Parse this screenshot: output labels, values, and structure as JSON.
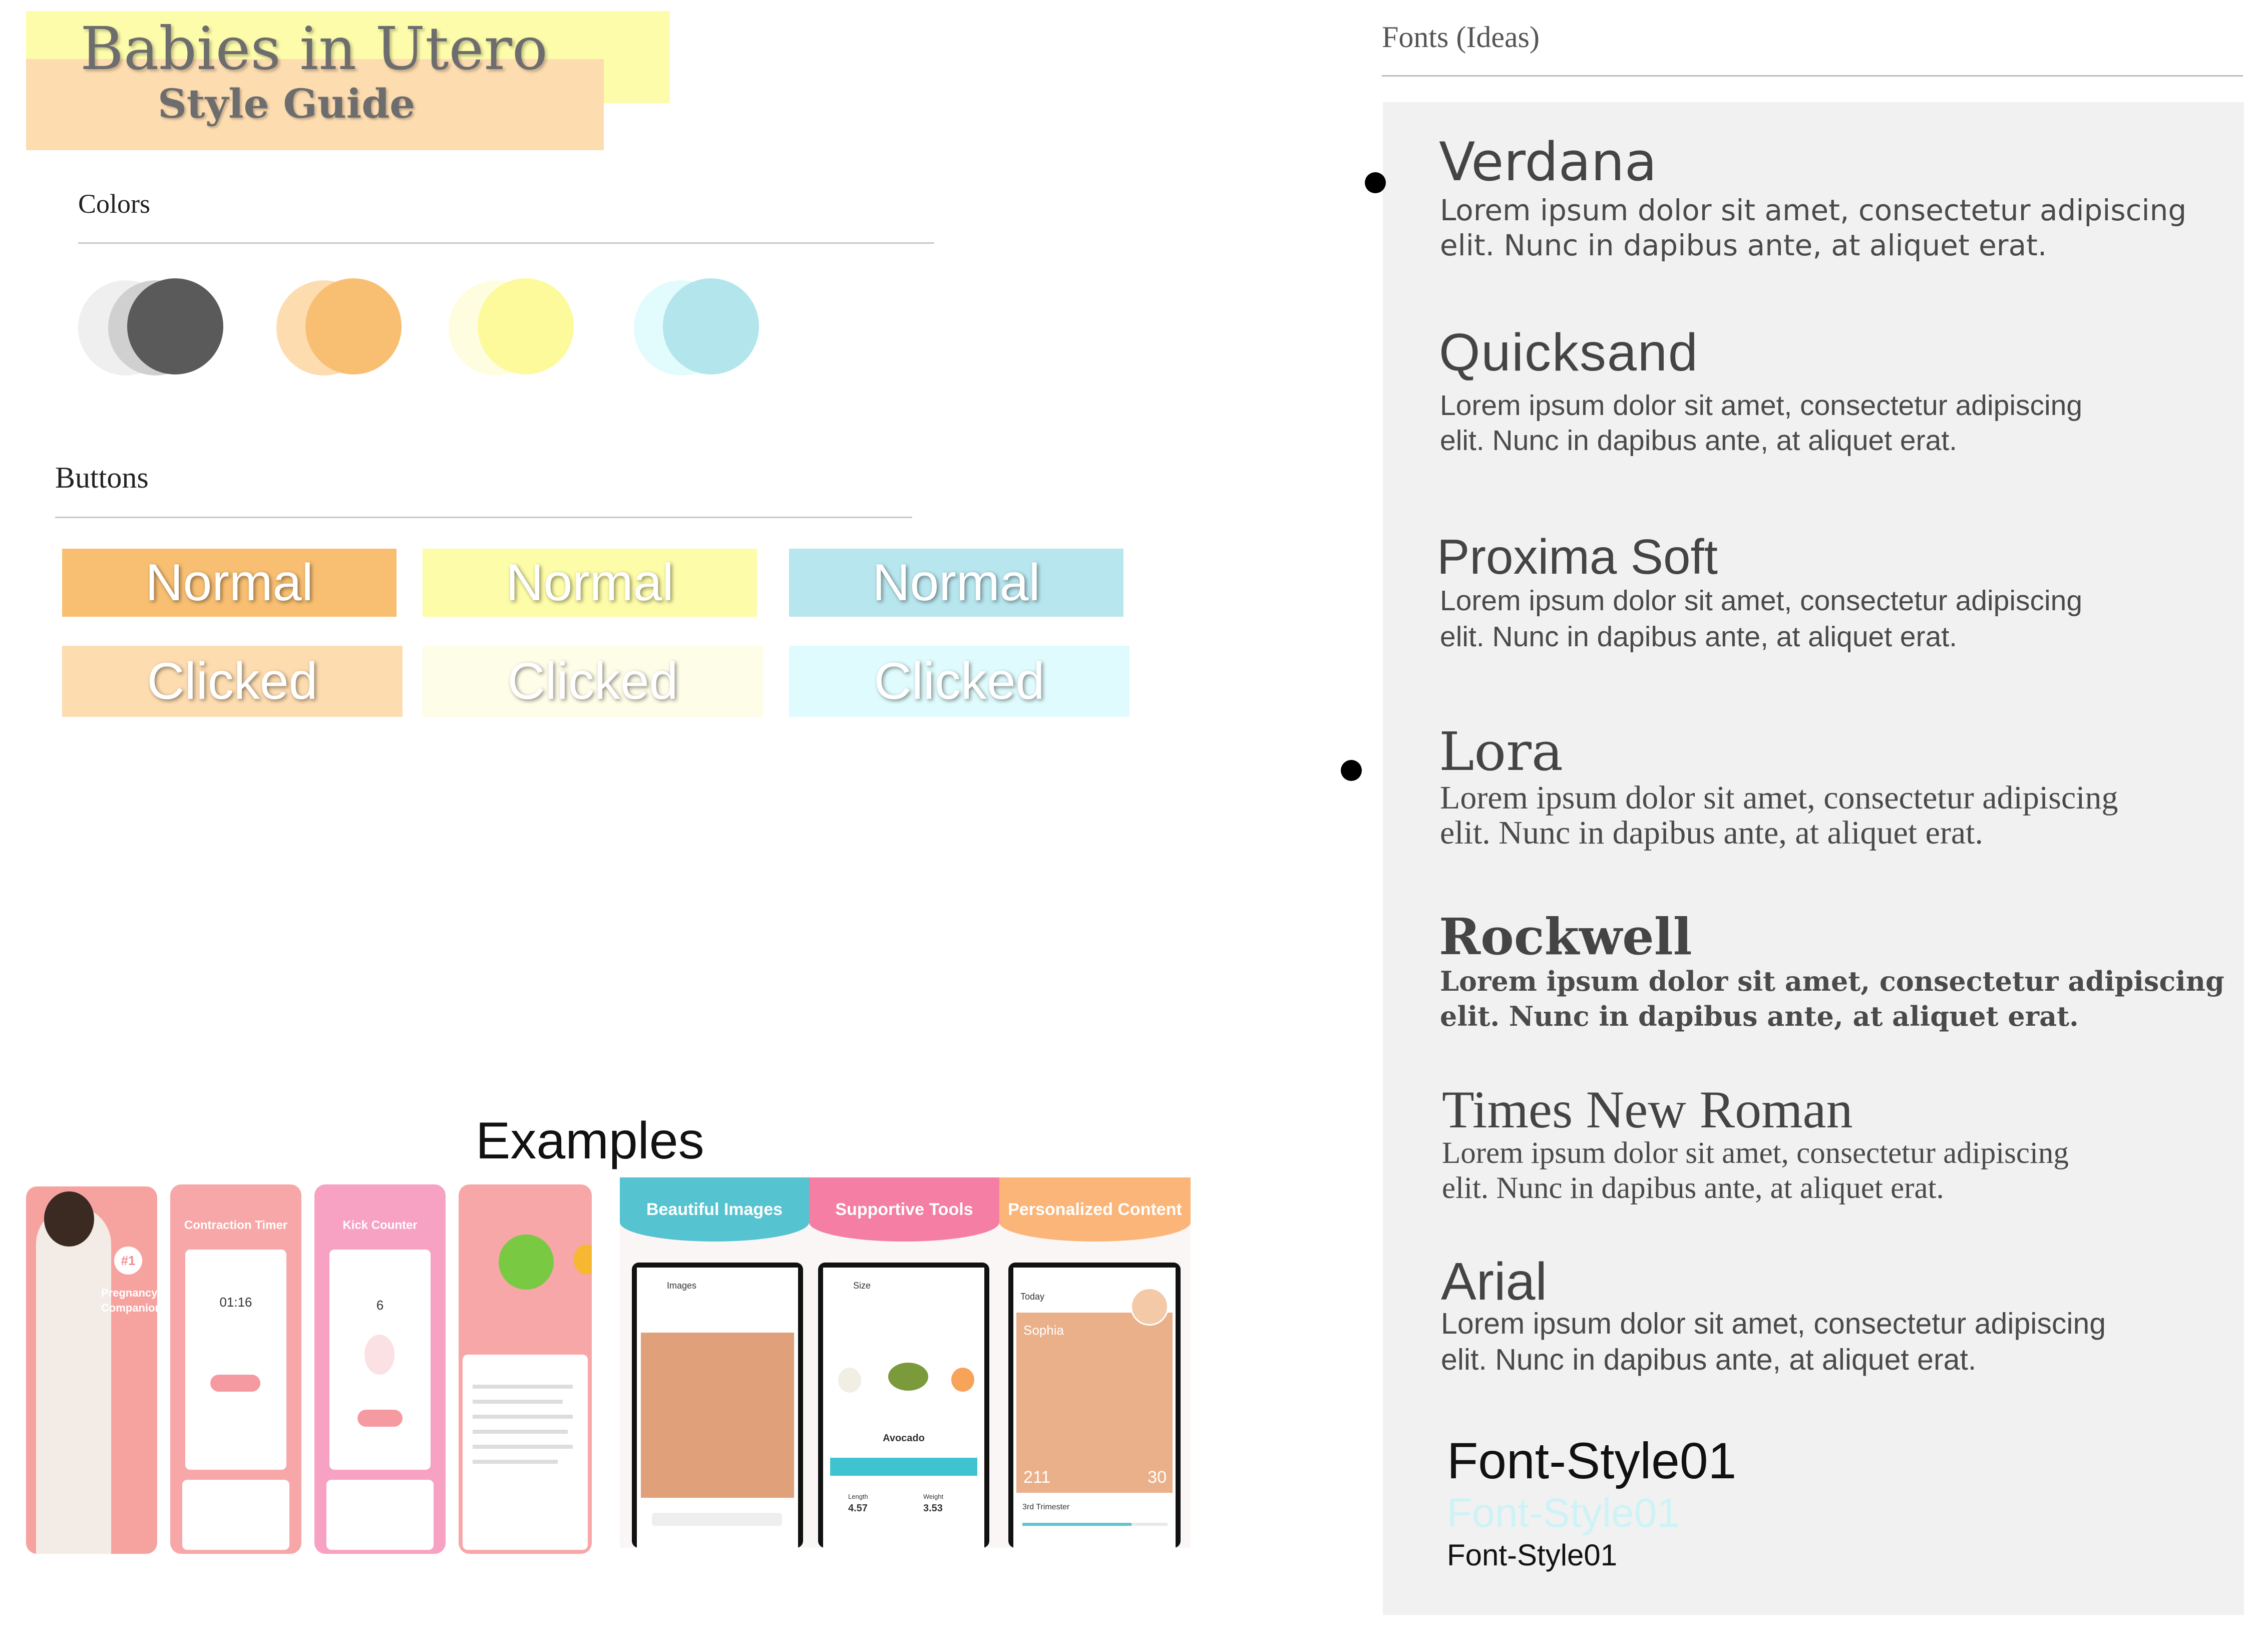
{
  "header": {
    "title": "Babies in Utero",
    "subtitle": "Style Guide"
  },
  "colors": {
    "heading": "Colors",
    "swatches": [
      {
        "name": "dark-gray",
        "main": "#5a5a5a",
        "light": "#efefef",
        "mid": "#d0d0d0"
      },
      {
        "name": "orange",
        "main": "#f8bf72",
        "light": "#fddcb0"
      },
      {
        "name": "yellow",
        "main": "#fdfa9c",
        "light": "#fefde0"
      },
      {
        "name": "aqua",
        "main": "#b3e5ec",
        "light": "#e2fbfd"
      }
    ]
  },
  "buttons": {
    "heading": "Buttons",
    "normal_label": "Normal",
    "clicked_label": "Clicked",
    "normal_colors": [
      "#f8bf72",
      "#fdfca8",
      "#b8e6ee"
    ],
    "clicked_colors": [
      "#fddcb0",
      "#fefde8",
      "#e0fbfd"
    ]
  },
  "examples": {
    "heading": "Examples",
    "left_app": {
      "hero_badge": "#1",
      "hero_text": [
        "Pregnancy",
        "Companion"
      ],
      "screens": [
        "Contraction Timer",
        "Kick Counter"
      ],
      "timer_value": "01:16",
      "kick_value": "6"
    },
    "right_app": {
      "panels": [
        "Beautiful Images",
        "Supportive Tools",
        "Personalized Content"
      ],
      "panel_colors": [
        "#56c3d1",
        "#f47ea4",
        "#fbb578"
      ],
      "images_title": "Images",
      "size_title": "Size",
      "fruit": "Avocado",
      "length_label": "Length",
      "length_value": "4.57",
      "weight_label": "Weight",
      "weight_value": "3.53",
      "today_label": "Today",
      "baby_name": "Sophia",
      "days_value": "211",
      "weeks_value": "30",
      "trimester": "3rd Trimester"
    }
  },
  "fonts": {
    "heading": "Fonts (Ideas)",
    "sample_line1": "Lorem ipsum dolor sit amet, consectetur adipiscing",
    "sample_line2": "elit. Nunc in dapibus ante, at aliquet erat.",
    "items": [
      {
        "name": "Verdana",
        "bullet": true
      },
      {
        "name": "Quicksand",
        "bullet": false
      },
      {
        "name": "Proxima Soft",
        "bullet": false
      },
      {
        "name": "Lora",
        "bullet": true
      },
      {
        "name": "Rockwell",
        "bullet": false
      },
      {
        "name": "Times New Roman",
        "bullet": false
      },
      {
        "name": "Arial",
        "bullet": false
      }
    ],
    "style_samples": [
      "Font-Style01",
      "Font-Style01",
      "Font-Style01"
    ],
    "style_colors": [
      "#111111",
      "#cdf3f7",
      "#111111"
    ]
  }
}
